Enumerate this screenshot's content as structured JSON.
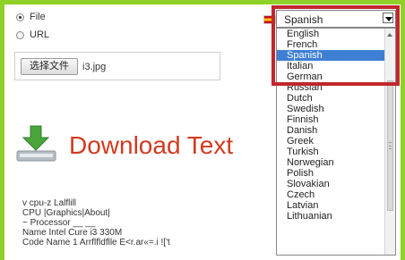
{
  "source_options": [
    {
      "label": "File",
      "checked": true
    },
    {
      "label": "URL",
      "checked": false
    }
  ],
  "file_input": {
    "button_label": "选择文件",
    "file_name": "i3.jpg"
  },
  "download": {
    "icon_name": "download-icon",
    "label": "Download Text"
  },
  "recognized_text": [
    "v cpu-z Lalflill",
    "CPU  |Graphics|About|",
    "~ Processor __ __",
    "Name Intel Cure i3 330M",
    "Code Name 1 Arrflfldflle E<r.ar«=.i !['t"
  ],
  "language_select": {
    "flag_icon": "spanish-flag-icon",
    "selected": "Spanish",
    "options": [
      "English",
      "French",
      "Spanish",
      "Italian",
      "German",
      "Russian",
      "Dutch",
      "Swedish",
      "Finnish",
      "Danish",
      "Greek",
      "Turkish",
      "Norwegian",
      "Polish",
      "Slovakian",
      "Czech",
      "Latvian",
      "Lithuanian"
    ]
  },
  "colors": {
    "background_green": "#8fd129",
    "title_red": "#d23a1f",
    "highlight_red": "#c1272d",
    "selected_blue": "#3e7fd4"
  }
}
